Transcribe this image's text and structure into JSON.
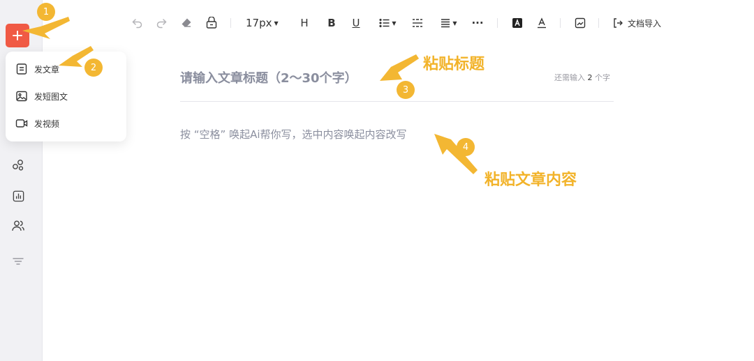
{
  "toolbar": {
    "font_size": "17px",
    "heading_label": "H",
    "bold_label": "B",
    "underline_label": "U",
    "more_label": "···",
    "import_label": "文档导入"
  },
  "menu": {
    "items": [
      {
        "label": "发文章",
        "icon": "document-icon"
      },
      {
        "label": "发短图文",
        "icon": "image-icon"
      },
      {
        "label": "发视频",
        "icon": "video-icon"
      }
    ]
  },
  "editor": {
    "title_placeholder": "请输入文章标题（2～30个字）",
    "counter_prefix": "还需输入",
    "counter_value": "2",
    "counter_suffix": "个字",
    "body_placeholder": "按 “空格” 唤起Ai帮你写，选中内容唤起内容改写"
  },
  "annotations": {
    "badges": [
      "1",
      "2",
      "3",
      "4"
    ],
    "paste_title": "粘贴标题",
    "paste_content": "粘贴文章内容"
  },
  "colors": {
    "accent": "#f05a45",
    "annotation": "#f3b733"
  }
}
